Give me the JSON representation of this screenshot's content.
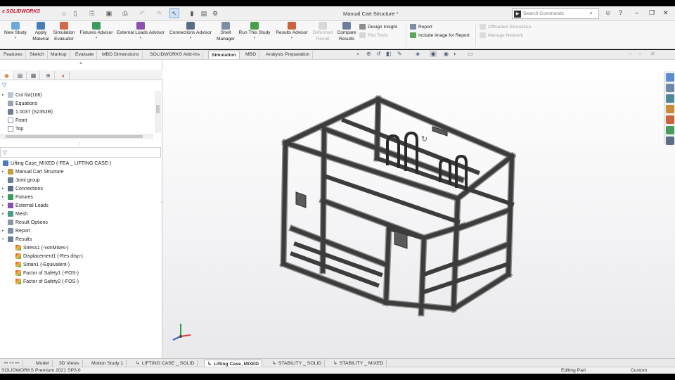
{
  "app": {
    "logo": "SOLIDWORKS",
    "document_title": "Manual Cart Structure *"
  },
  "search": {
    "placeholder": "Search Commands"
  },
  "ribbon": {
    "new_study": [
      "New Study"
    ],
    "apply_material": [
      "Apply",
      "Material"
    ],
    "simulation_evaluator": [
      "Simulation",
      "Evaluator"
    ],
    "fixtures_advisor": [
      "Fixtures Advisor"
    ],
    "external_loads_advisor": [
      "External Loads Advisor"
    ],
    "connections_advisor": [
      "Connections Advisor"
    ],
    "shell_manager": [
      "Shell",
      "Manager"
    ],
    "run_this_study": [
      "Run This Study"
    ],
    "results_advisor": [
      "Results Advisor"
    ],
    "deformed_result": [
      "Deformed",
      "Result"
    ],
    "compare_results": [
      "Compare",
      "Results"
    ],
    "design_insight": "Design Insight",
    "plot_tools": "Plot Tools",
    "report": "Report",
    "include_image": "Include Image for Report",
    "simulation_offloaded": "Offloaded Simulation",
    "manage_network": "Manage Network"
  },
  "command_tabs": [
    "Features",
    "Sketch",
    "Markup",
    "Evaluate",
    "MBD Dimensions",
    "SOLIDWORKS Add-Ins",
    "Simulation",
    "MBD",
    "Analysis Preparation"
  ],
  "active_command_tab": "Simulation",
  "part_tree": [
    {
      "label": "Cut list(106)",
      "expand": "▸"
    },
    {
      "label": "Equations",
      "expand": ""
    },
    {
      "label": "1.0037 (S235JR)",
      "expand": ""
    },
    {
      "label": "Front",
      "expand": ""
    },
    {
      "label": "Top",
      "expand": ""
    }
  ],
  "study": {
    "title": "Lifting Case_MIXED (-FEA _ LIFTING CASE-)",
    "items": [
      {
        "label": "Manual Cart Structure",
        "expand": "▸"
      },
      {
        "label": "Joint group",
        "expand": ""
      },
      {
        "label": "Connections",
        "expand": "▸"
      },
      {
        "label": "Fixtures",
        "expand": "▸"
      },
      {
        "label": "External Loads",
        "expand": "▸"
      },
      {
        "label": "Mesh",
        "expand": "▸"
      },
      {
        "label": "Result Options",
        "expand": ""
      },
      {
        "label": "Report",
        "expand": "▸"
      },
      {
        "label": "Results",
        "expand": "▾"
      }
    ],
    "results": [
      "Stress1 (-vonMises-)",
      "Displacement1 (-Res disp-)",
      "Strain1 (-Equivalent-)",
      "Factor of Safety1 (-FOS-)",
      "Factor of Safety2 (-FOS-)"
    ]
  },
  "bottom_tabs": [
    "Model",
    "3D Views",
    "Motion Study 1",
    "LIFTING CASE _ SOLID",
    "Lifting Case_MIXED",
    "STABILITY _ SOLID",
    "STABILITY _ MIXED"
  ],
  "active_bottom_tab": "Lifting Case_MIXED",
  "status": {
    "product": "SOLIDWORKS Premium 2021 SP3.0",
    "mode": "Editing Part",
    "units": "Custom"
  },
  "colors": {
    "accent": "#c8102e",
    "active_tab": "#ffffff",
    "frame": "#3c3c3c"
  }
}
